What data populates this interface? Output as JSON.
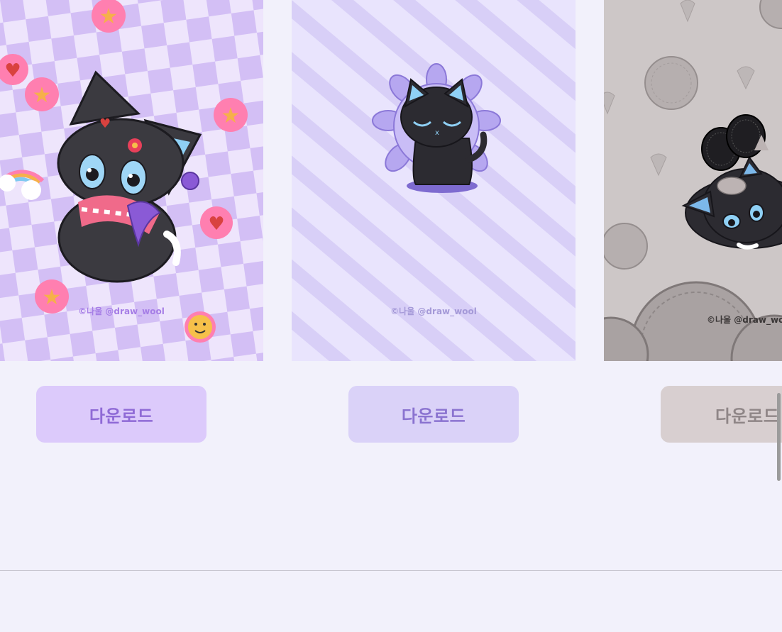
{
  "wallpapers": [
    {
      "credit": "©나울 @draw_wool",
      "download_label": "다운로드",
      "theme": "checker-stickers",
      "accent": "#dccafb"
    },
    {
      "credit": "©나울 @draw_wool",
      "download_label": "다운로드",
      "theme": "flower-stripes",
      "accent": "#dad2f8"
    },
    {
      "credit": "©나울 @draw_woo",
      "download_label": "다운로드",
      "theme": "cookies",
      "accent": "#d8cfd0"
    }
  ]
}
